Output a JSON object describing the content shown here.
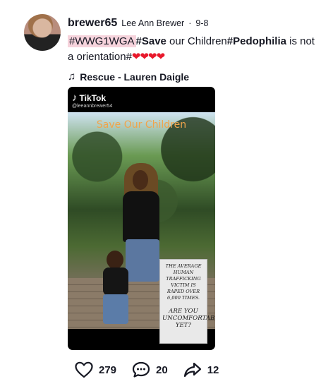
{
  "post": {
    "username": "brewer65",
    "nickname": "Lee Ann Brewer",
    "separator": "·",
    "date": "9-8",
    "caption": {
      "highlight_tag": "#WWG1WGA",
      "tag_save": "#Save",
      "text_1": " our Children",
      "tag_pedophilia": "#Pedophilia",
      "text_2": " is not a orientation",
      "hash_end": "#",
      "hearts": "❤❤❤❤"
    },
    "music": {
      "icon": "music-note-icon",
      "title": "Rescue - Lauren Daigle"
    }
  },
  "video": {
    "logo_note": "♪",
    "logo_word": "TikTok",
    "handle": "@leeannbrewer54",
    "title_text": "Save Our Children",
    "sign_line_1": "THE AVERAGE HUMAN TRAFFICKING VICTIM IS RAPED OVER 6,000 TIMES.",
    "sign_line_2": "ARE YOU UNCOMFORTABLE YET?"
  },
  "actions": {
    "like_count": "279",
    "comment_count": "20",
    "share_count": "12",
    "like_icon": "heart-icon",
    "comment_icon": "comment-icon",
    "share_icon": "share-icon"
  },
  "colors": {
    "highlight": "#f6d3dc",
    "hearts": "#e8192c",
    "overlay_title": "#f0a44b"
  }
}
